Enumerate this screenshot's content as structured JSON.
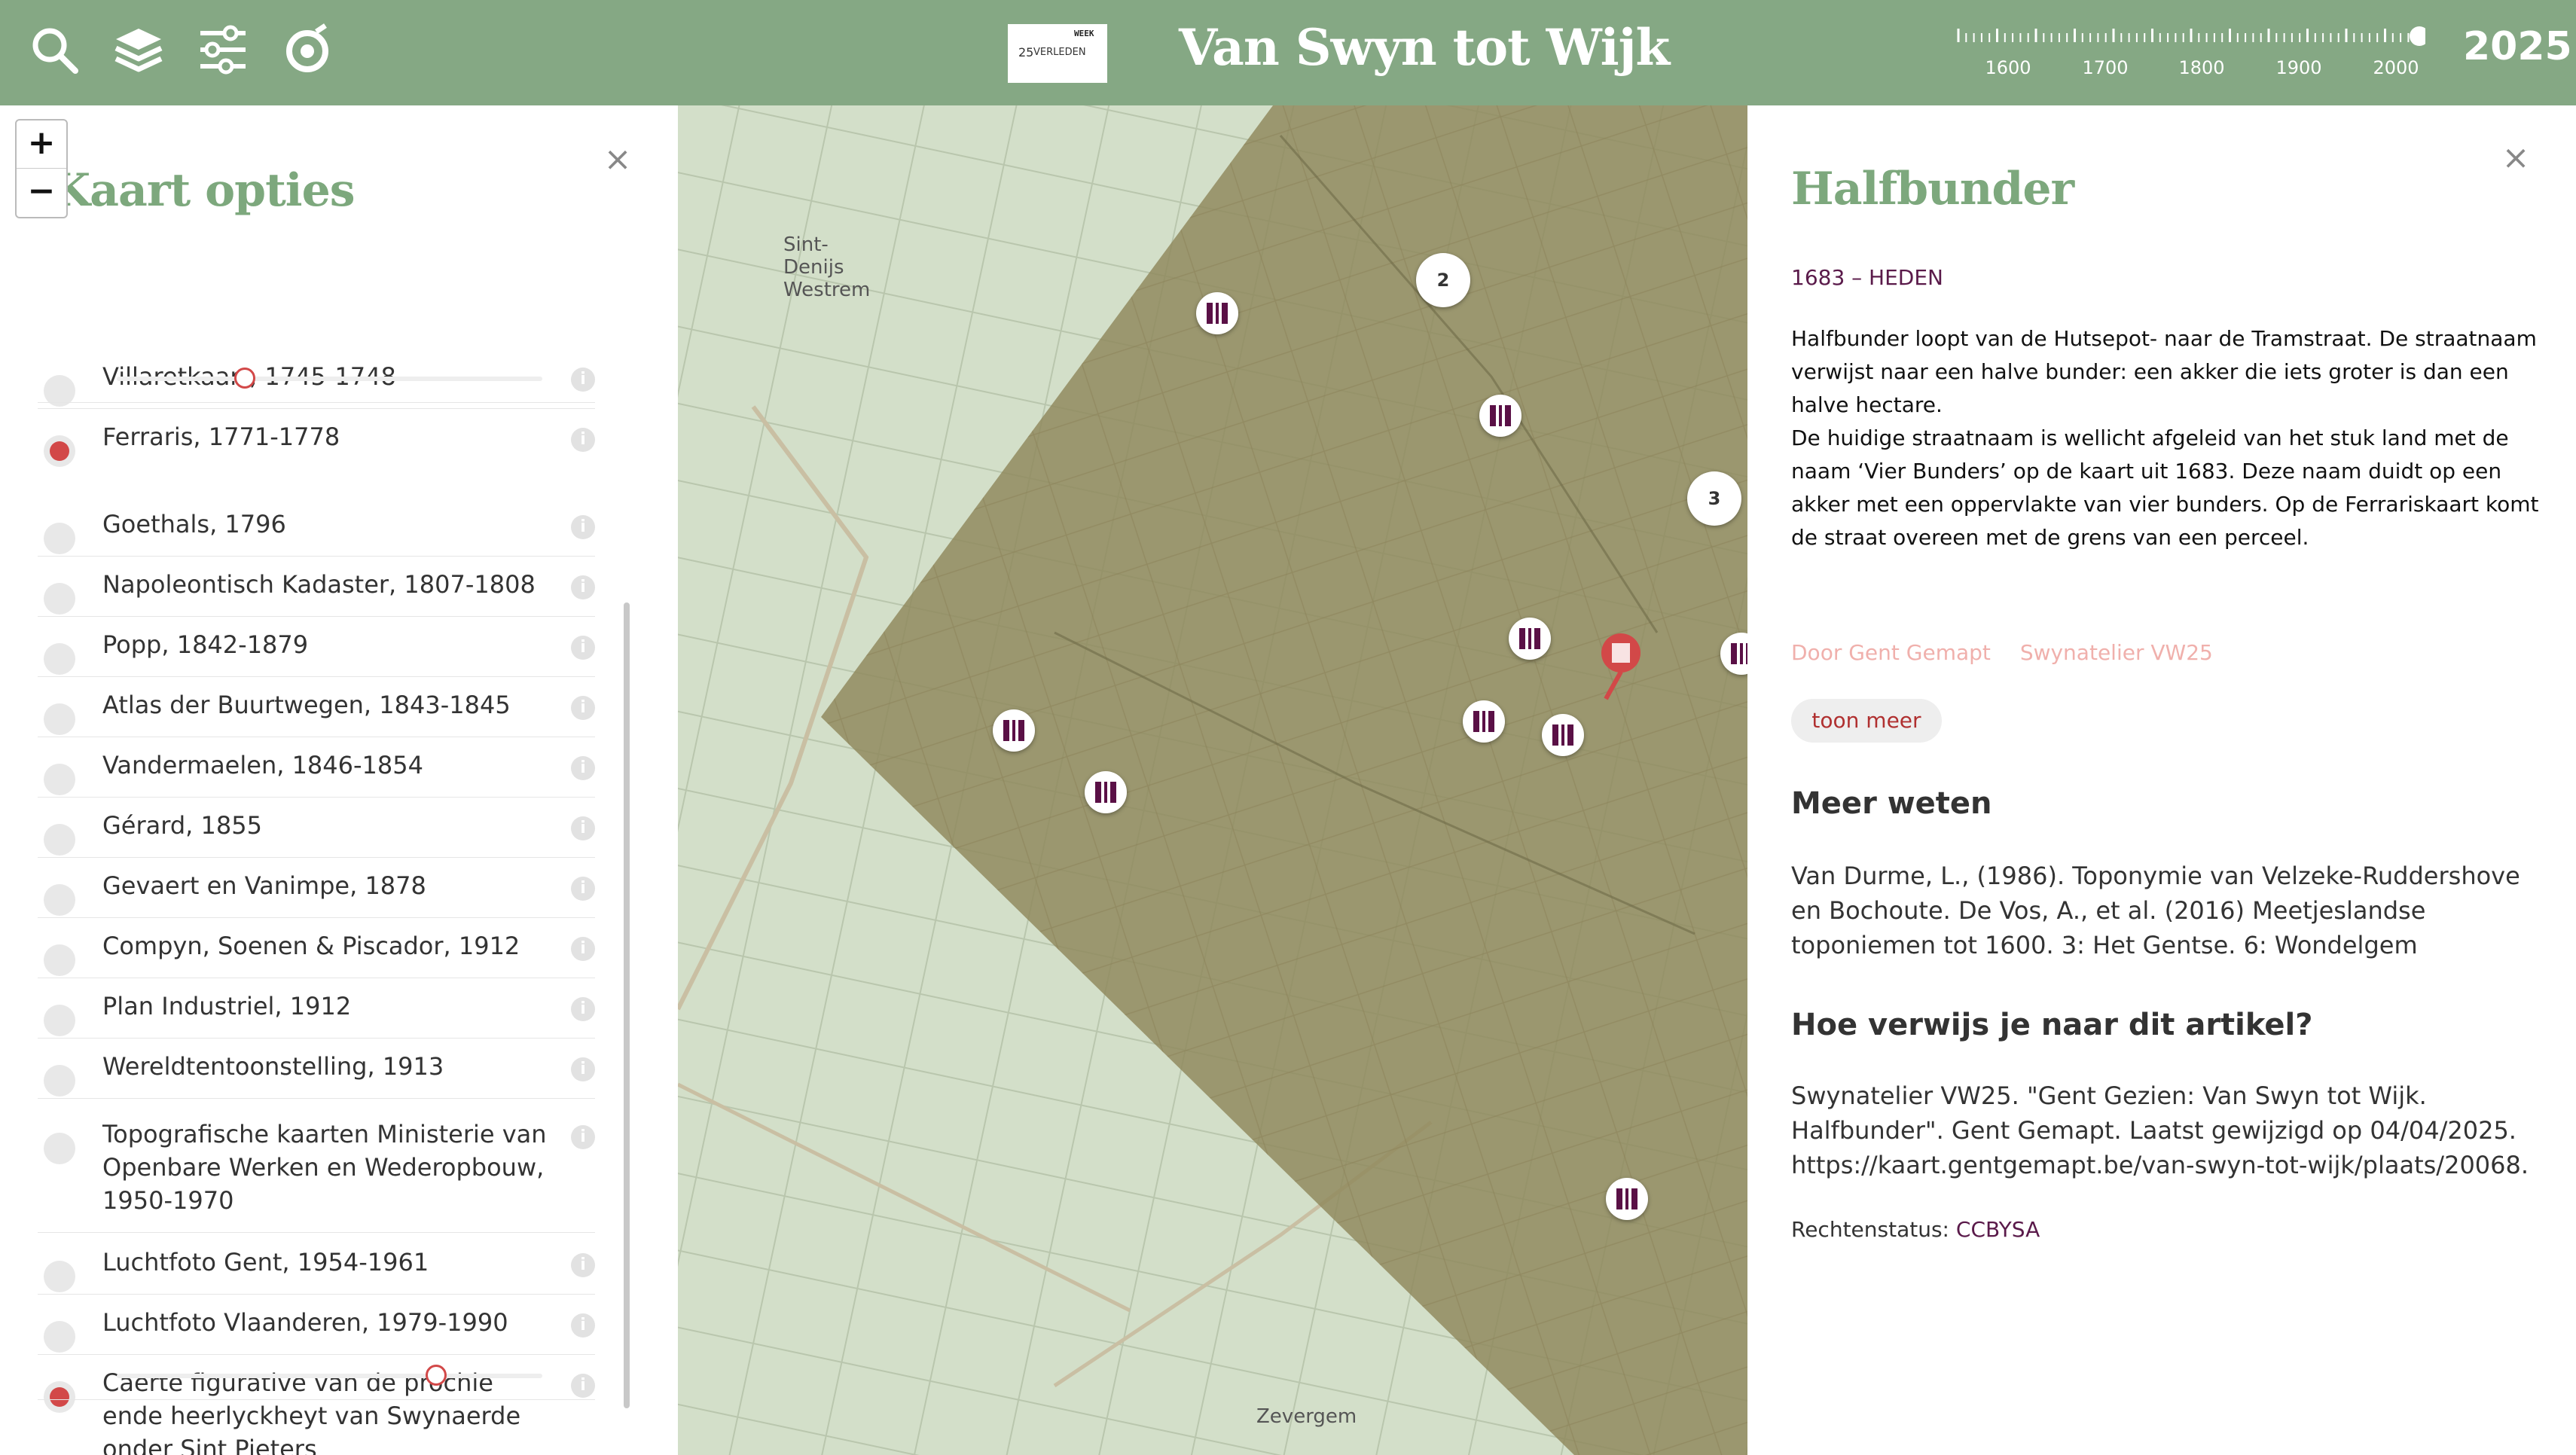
{
  "header": {
    "logo_number": "25",
    "logo_vertical": "VERLEDEN",
    "logo_vertical2": "WEEK",
    "title": "Van Swyn tot Wijk",
    "timeline_labels": [
      "1600",
      "1700",
      "1800",
      "1900",
      "2000"
    ],
    "timeline_year": "2025",
    "icons": [
      "search-icon",
      "layers-icon",
      "filter-sliders-icon",
      "location-target-icon"
    ]
  },
  "map": {
    "zoom_in": "+",
    "zoom_out": "−",
    "labels": {
      "sint_denijs": "Sint-Denijs Westrem",
      "zevergem": "Zevergem"
    },
    "clusters": [
      "2",
      "3"
    ]
  },
  "left_panel": {
    "title": "Kaart opties",
    "close": "×",
    "layers": [
      {
        "label": "Villaretkaart, 1745-1748",
        "active": false
      },
      {
        "label": "Ferraris, 1771-1778",
        "active": true,
        "opacity": 0.3
      },
      {
        "label": "Goethals, 1796",
        "active": false
      },
      {
        "label": "Napoleontisch Kadaster, 1807-1808",
        "active": false
      },
      {
        "label": "Popp, 1842-1879",
        "active": false
      },
      {
        "label": "Atlas der Buurtwegen, 1843-1845",
        "active": false
      },
      {
        "label": "Vandermaelen, 1846-1854",
        "active": false
      },
      {
        "label": "Gérard, 1855",
        "active": false
      },
      {
        "label": "Gevaert en Vanimpe, 1878",
        "active": false
      },
      {
        "label": "Compyn, Soenen & Piscador, 1912",
        "active": false
      },
      {
        "label": "Plan Industriel, 1912",
        "active": false
      },
      {
        "label": "Wereldtentoonstelling, 1913",
        "active": false
      },
      {
        "label": "Topografische kaarten Ministerie van Openbare Werken en Wederopbouw, 1950-1970",
        "active": false
      },
      {
        "label": "Luchtfoto Gent, 1954-1961",
        "active": false
      },
      {
        "label": "Luchtfoto Vlaanderen, 1979-1990",
        "active": false
      },
      {
        "label": "Caerte figurative van de prochie ende heerlyckheyt van Swynaerde onder Sint Pieters",
        "active": true,
        "opacity": 0.75
      }
    ],
    "info_glyph": "i"
  },
  "right_panel": {
    "close": "×",
    "title": "Halfbunder",
    "date": "1683 – HEDEN",
    "body": "Halfbunder loopt van de Hutsepot- naar de Tramstraat. De straatnaam verwijst naar een halve bunder: een akker die iets groter is dan een halve hectare.\nDe huidige straatnaam is wellicht afgeleid van het stuk land met de naam ‘Vier Bunders’ op de kaart uit 1683. Deze naam duidt op een akker met een oppervlakte van vier bunders. Op de Ferrariskaart komt de straat overeen met de grens van een perceel.",
    "faded_credit": "Door Gent Gemapt",
    "faded_credit2": "Swynatelier VW25",
    "more_button": "toon meer",
    "meer_weten_heading": "Meer weten",
    "meer_weten_text": "Van Durme, L., (1986). Toponymie van Velzeke-Ruddershove en Bochoute. De Vos, A., et al. (2016) Meetjeslandse toponiemen tot 1600. 3: Het Gentse. 6: Wondelgem",
    "citation_heading": "Hoe verwijs je naar dit artikel?",
    "citation_text": "Swynatelier VW25. \"Gent Gezien: Van Swyn tot Wijk. Halfbunder\". Gent Gemapt. Laatst gewijzigd op 04/04/2025. https://kaart.gentgemapt.be/van-swyn-tot-wijk/plaats/20068.",
    "rights_label": "Rechtenstatus:",
    "rights_value": "CCBYSA"
  },
  "colors": {
    "header": "#85a884",
    "title_green": "#7da87d",
    "accent_red": "#d24848",
    "marker_purple": "#5a1046"
  }
}
